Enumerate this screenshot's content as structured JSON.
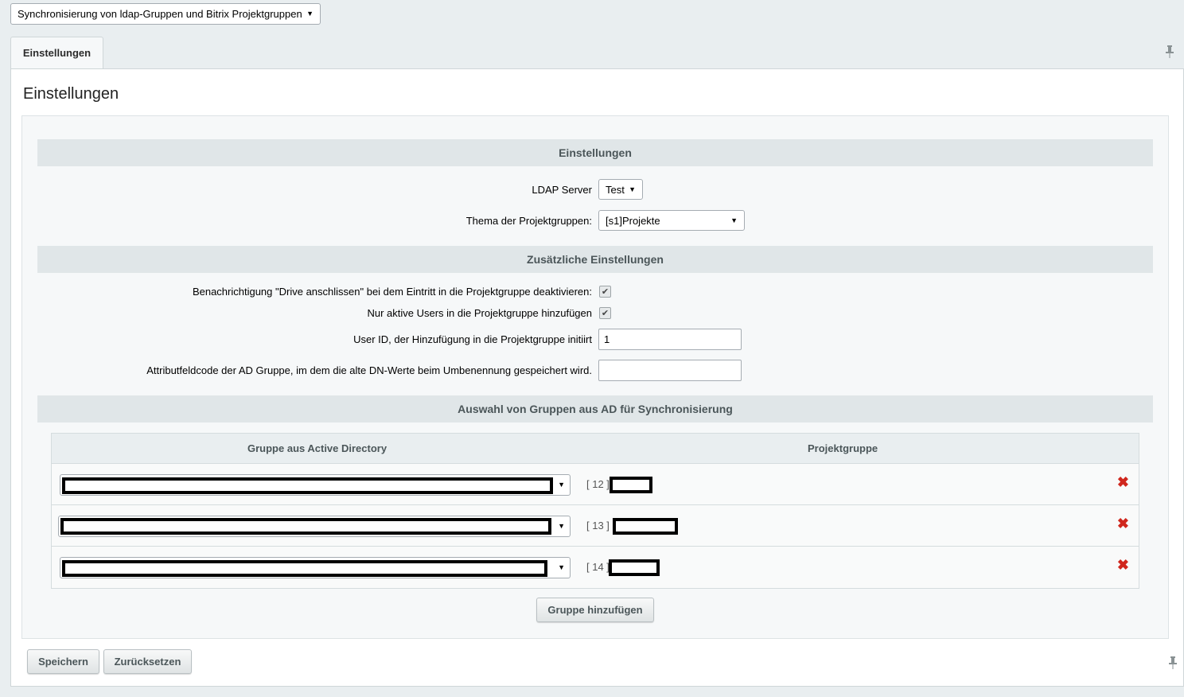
{
  "top_select": {
    "value": "Synchronisierung von ldap-Gruppen und Bitrix Projektgruppen"
  },
  "tabs": [
    {
      "label": "Einstellungen"
    }
  ],
  "page_title": "Einstellungen",
  "sections": {
    "settings": {
      "title": "Einstellungen"
    },
    "additional": {
      "title": "Zusätzliche Einstellungen"
    },
    "groups": {
      "title": "Auswahl von Gruppen aus AD für Synchronisierung"
    }
  },
  "fields": {
    "ldap_server": {
      "label": "LDAP Server",
      "value": "Test"
    },
    "theme": {
      "label": "Thema der Projektgruppen:",
      "value": "[s1]Projekte"
    },
    "notify_drive": {
      "label": "Benachrichtigung \"Drive anschlissen\" bei dem Eintritt in die Projektgruppe deaktivieren:",
      "checked": true
    },
    "only_active": {
      "label": "Nur aktive Users in die Projektgruppe hinzufügen",
      "checked": true
    },
    "user_id": {
      "label": "User ID, der Hinzufügung in die Projektgruppe initiirt",
      "value": "1"
    },
    "attr_code": {
      "label": "Attributfeldcode der AD Gruppe, im dem die alte DN-Werte beim Umbenennung gespeichert wird.",
      "value": ""
    }
  },
  "group_table": {
    "headers": {
      "ad_group": "Gruppe aus Active Directory",
      "project_group": "Projektgruppe"
    },
    "rows": [
      {
        "id": "[ 12 ]"
      },
      {
        "id": "[ 13 ]"
      },
      {
        "id": "[ 14 ]"
      }
    ],
    "add_button": "Gruppe hinzufügen"
  },
  "footer": {
    "save": "Speichern",
    "reset": "Zurücksetzen"
  },
  "icons": {
    "dropdown": "▼",
    "check": "✔",
    "delete": "✖",
    "pin": "pin-icon"
  }
}
